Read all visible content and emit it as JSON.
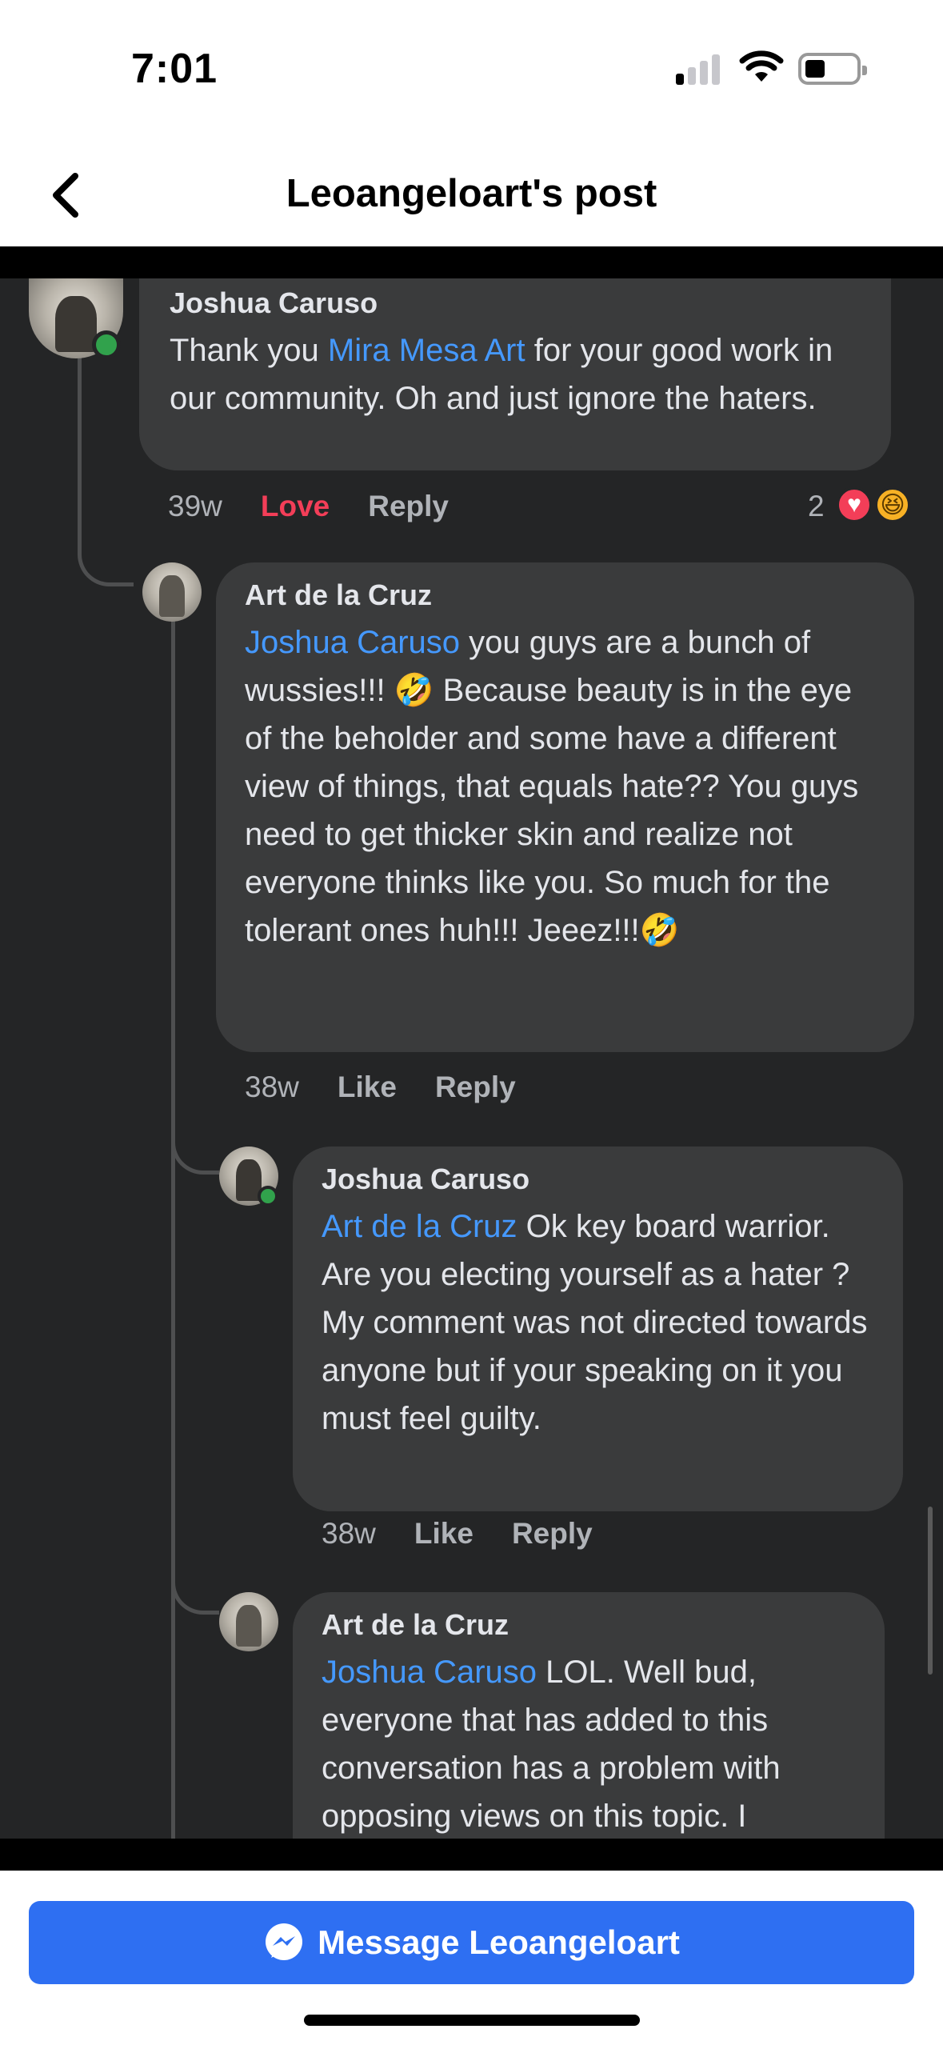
{
  "status_bar": {
    "time": "7:01"
  },
  "nav": {
    "title": "Leoangeloart's post"
  },
  "comments": [
    {
      "author": "Joshua Caruso",
      "mention": "Mira Mesa Art",
      "before": "Thank you ",
      "after": " for your good work in our community. Oh and just ignore the haters.",
      "age": "39w",
      "reaction_action": "Love",
      "reply": "Reply",
      "reaction_count": "2"
    },
    {
      "author": "Art de la Cruz",
      "mention": "Joshua Caruso",
      "after": " you guys are a bunch of wussies!!! 🤣 Because beauty is in the eye of the beholder and some have a different view of things, that equals hate?? You guys need to get thicker skin and realize not everyone thinks like you. So much for the tolerant ones huh!!! Jeeez!!!🤣",
      "age": "38w",
      "like": "Like",
      "reply": "Reply"
    },
    {
      "author": "Joshua Caruso",
      "mention": "Art de la Cruz",
      "after": " Ok key board warrior. Are you electing yourself as a hater ? My comment was not directed towards anyone but if your speaking on it you must feel guilty.",
      "age": "38w",
      "like": "Like",
      "reply": "Reply"
    },
    {
      "author": "Art de la Cruz",
      "mention": "Joshua Caruso",
      "after": " LOL. Well bud, everyone that has added to this conversation has a problem with opposing views on this topic. I"
    }
  ],
  "bottom": {
    "message_button": "Message Leoangeloart"
  },
  "colors": {
    "accent": "#2e6ff2",
    "mention": "#4599ff",
    "love": "#f33e58"
  }
}
